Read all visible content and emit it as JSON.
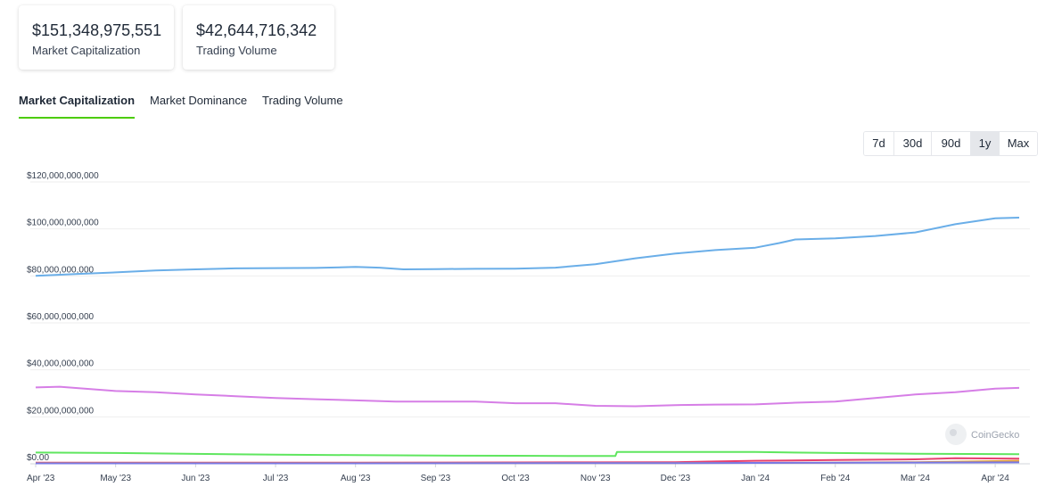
{
  "stats": {
    "market_cap": {
      "value": "$151,348,975,551",
      "label": "Market Capitalization"
    },
    "trading_volume": {
      "value": "$42,644,716,342",
      "label": "Trading Volume"
    }
  },
  "tabs": [
    {
      "label": "Market Capitalization",
      "active": true
    },
    {
      "label": "Market Dominance",
      "active": false
    },
    {
      "label": "Trading Volume",
      "active": false
    }
  ],
  "ranges": [
    {
      "label": "7d",
      "selected": false
    },
    {
      "label": "30d",
      "selected": false
    },
    {
      "label": "90d",
      "selected": false
    },
    {
      "label": "1y",
      "selected": true
    },
    {
      "label": "Max",
      "selected": false
    }
  ],
  "watermark": "CoinGecko",
  "chart_data": {
    "type": "line",
    "ylim": [
      0,
      120000000000
    ],
    "y_ticks": [
      "$0.00",
      "$20,000,000,000",
      "$40,000,000,000",
      "$60,000,000,000",
      "$80,000,000,000",
      "$100,000,000,000",
      "$120,000,000,000"
    ],
    "y_tick_values": [
      0,
      20000000000,
      40000000000,
      60000000000,
      80000000000,
      100000000000,
      120000000000
    ],
    "x_ticks": [
      "Apr '23",
      "May '23",
      "Jun '23",
      "Jul '23",
      "Aug '23",
      "Sep '23",
      "Oct '23",
      "Nov '23",
      "Dec '23",
      "Jan '24",
      "Feb '24",
      "Mar '24",
      "Apr '24"
    ],
    "x_range": [
      0,
      12.3
    ],
    "grid": true,
    "legend": "none",
    "series": [
      {
        "color": "#6aaee8",
        "points": [
          [
            0,
            80.0
          ],
          [
            0.5,
            80.8
          ],
          [
            1,
            81.5
          ],
          [
            1.5,
            82.3
          ],
          [
            2,
            82.8
          ],
          [
            2.5,
            83.2
          ],
          [
            3,
            83.3
          ],
          [
            3.5,
            83.4
          ],
          [
            4,
            83.8
          ],
          [
            4.3,
            83.5
          ],
          [
            4.6,
            82.8
          ],
          [
            5,
            82.9
          ],
          [
            5.5,
            83.0
          ],
          [
            6,
            83.1
          ],
          [
            6.5,
            83.5
          ],
          [
            7,
            85.0
          ],
          [
            7.5,
            87.5
          ],
          [
            8,
            89.5
          ],
          [
            8.5,
            91.0
          ],
          [
            9,
            92.0
          ],
          [
            9.3,
            94.0
          ],
          [
            9.5,
            95.5
          ],
          [
            10,
            96.0
          ],
          [
            10.5,
            97.0
          ],
          [
            11,
            98.5
          ],
          [
            11.5,
            102.0
          ],
          [
            12,
            104.5
          ],
          [
            12.3,
            104.8
          ]
        ]
      },
      {
        "color": "#d67ee6",
        "points": [
          [
            0,
            32.5
          ],
          [
            0.3,
            32.8
          ],
          [
            1,
            31.0
          ],
          [
            1.5,
            30.5
          ],
          [
            2,
            29.5
          ],
          [
            2.5,
            28.8
          ],
          [
            3,
            28.0
          ],
          [
            3.5,
            27.5
          ],
          [
            4,
            27.0
          ],
          [
            4.5,
            26.5
          ],
          [
            5,
            26.5
          ],
          [
            5.5,
            26.5
          ],
          [
            6,
            25.8
          ],
          [
            6.5,
            25.8
          ],
          [
            7,
            24.7
          ],
          [
            7.5,
            24.5
          ],
          [
            8,
            25.0
          ],
          [
            8.5,
            25.2
          ],
          [
            9,
            25.3
          ],
          [
            9.5,
            26.0
          ],
          [
            10,
            26.5
          ],
          [
            10.5,
            28.0
          ],
          [
            11,
            29.5
          ],
          [
            11.5,
            30.5
          ],
          [
            12,
            32.0
          ],
          [
            12.3,
            32.3
          ]
        ]
      },
      {
        "color": "#5fe65f",
        "points": [
          [
            0,
            4.8
          ],
          [
            1,
            4.6
          ],
          [
            2,
            4.2
          ],
          [
            3,
            3.9
          ],
          [
            4,
            3.7
          ],
          [
            5,
            3.5
          ],
          [
            6,
            3.4
          ],
          [
            7,
            3.3
          ],
          [
            7.25,
            3.3
          ],
          [
            7.27,
            5.0
          ],
          [
            8,
            5.0
          ],
          [
            9,
            5.0
          ],
          [
            10,
            4.6
          ],
          [
            11,
            4.3
          ],
          [
            12.3,
            4.1
          ]
        ]
      },
      {
        "color": "#e8406e",
        "points": [
          [
            0,
            0.5
          ],
          [
            4,
            0.5
          ],
          [
            7,
            0.6
          ],
          [
            8,
            0.7
          ],
          [
            8.5,
            1.0
          ],
          [
            9,
            1.3
          ],
          [
            10,
            1.6
          ],
          [
            11,
            1.9
          ],
          [
            11.5,
            2.4
          ],
          [
            12.3,
            2.2
          ]
        ]
      },
      {
        "color": "#e8a23a",
        "points": [
          [
            0,
            0.3
          ],
          [
            8,
            0.3
          ],
          [
            10,
            0.5
          ],
          [
            11,
            0.7
          ],
          [
            11.5,
            0.9
          ],
          [
            12.3,
            1.3
          ]
        ]
      },
      {
        "color": "#7878e6",
        "points": [
          [
            0,
            0.2
          ],
          [
            4,
            0.2
          ],
          [
            8,
            0.3
          ],
          [
            12.3,
            0.6
          ]
        ]
      }
    ]
  }
}
